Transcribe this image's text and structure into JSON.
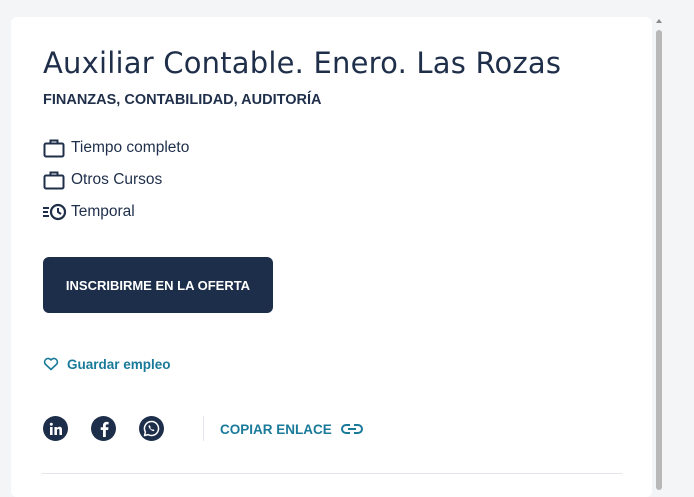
{
  "job": {
    "title": "Auxiliar Contable. Enero. Las Rozas",
    "category": "FINANZAS, CONTABILIDAD, AUDITORÍA",
    "attributes": [
      {
        "icon": "briefcase-icon",
        "label": "Tiempo completo"
      },
      {
        "icon": "briefcase-icon",
        "label": "Otros Cursos"
      },
      {
        "icon": "schedule-clock-icon",
        "label": "Temporal"
      }
    ]
  },
  "actions": {
    "apply_label": "INSCRIBIRME EN LA OFERTA",
    "save_label": "Guardar empleo",
    "copy_link_label": "COPIAR ENLACE"
  },
  "share": {
    "networks": [
      "linkedin-icon",
      "facebook-icon",
      "whatsapp-icon"
    ]
  },
  "colors": {
    "primary": "#1d2e4a",
    "link": "#1a7a9a",
    "background": "#f4f5f7",
    "card": "#ffffff"
  }
}
